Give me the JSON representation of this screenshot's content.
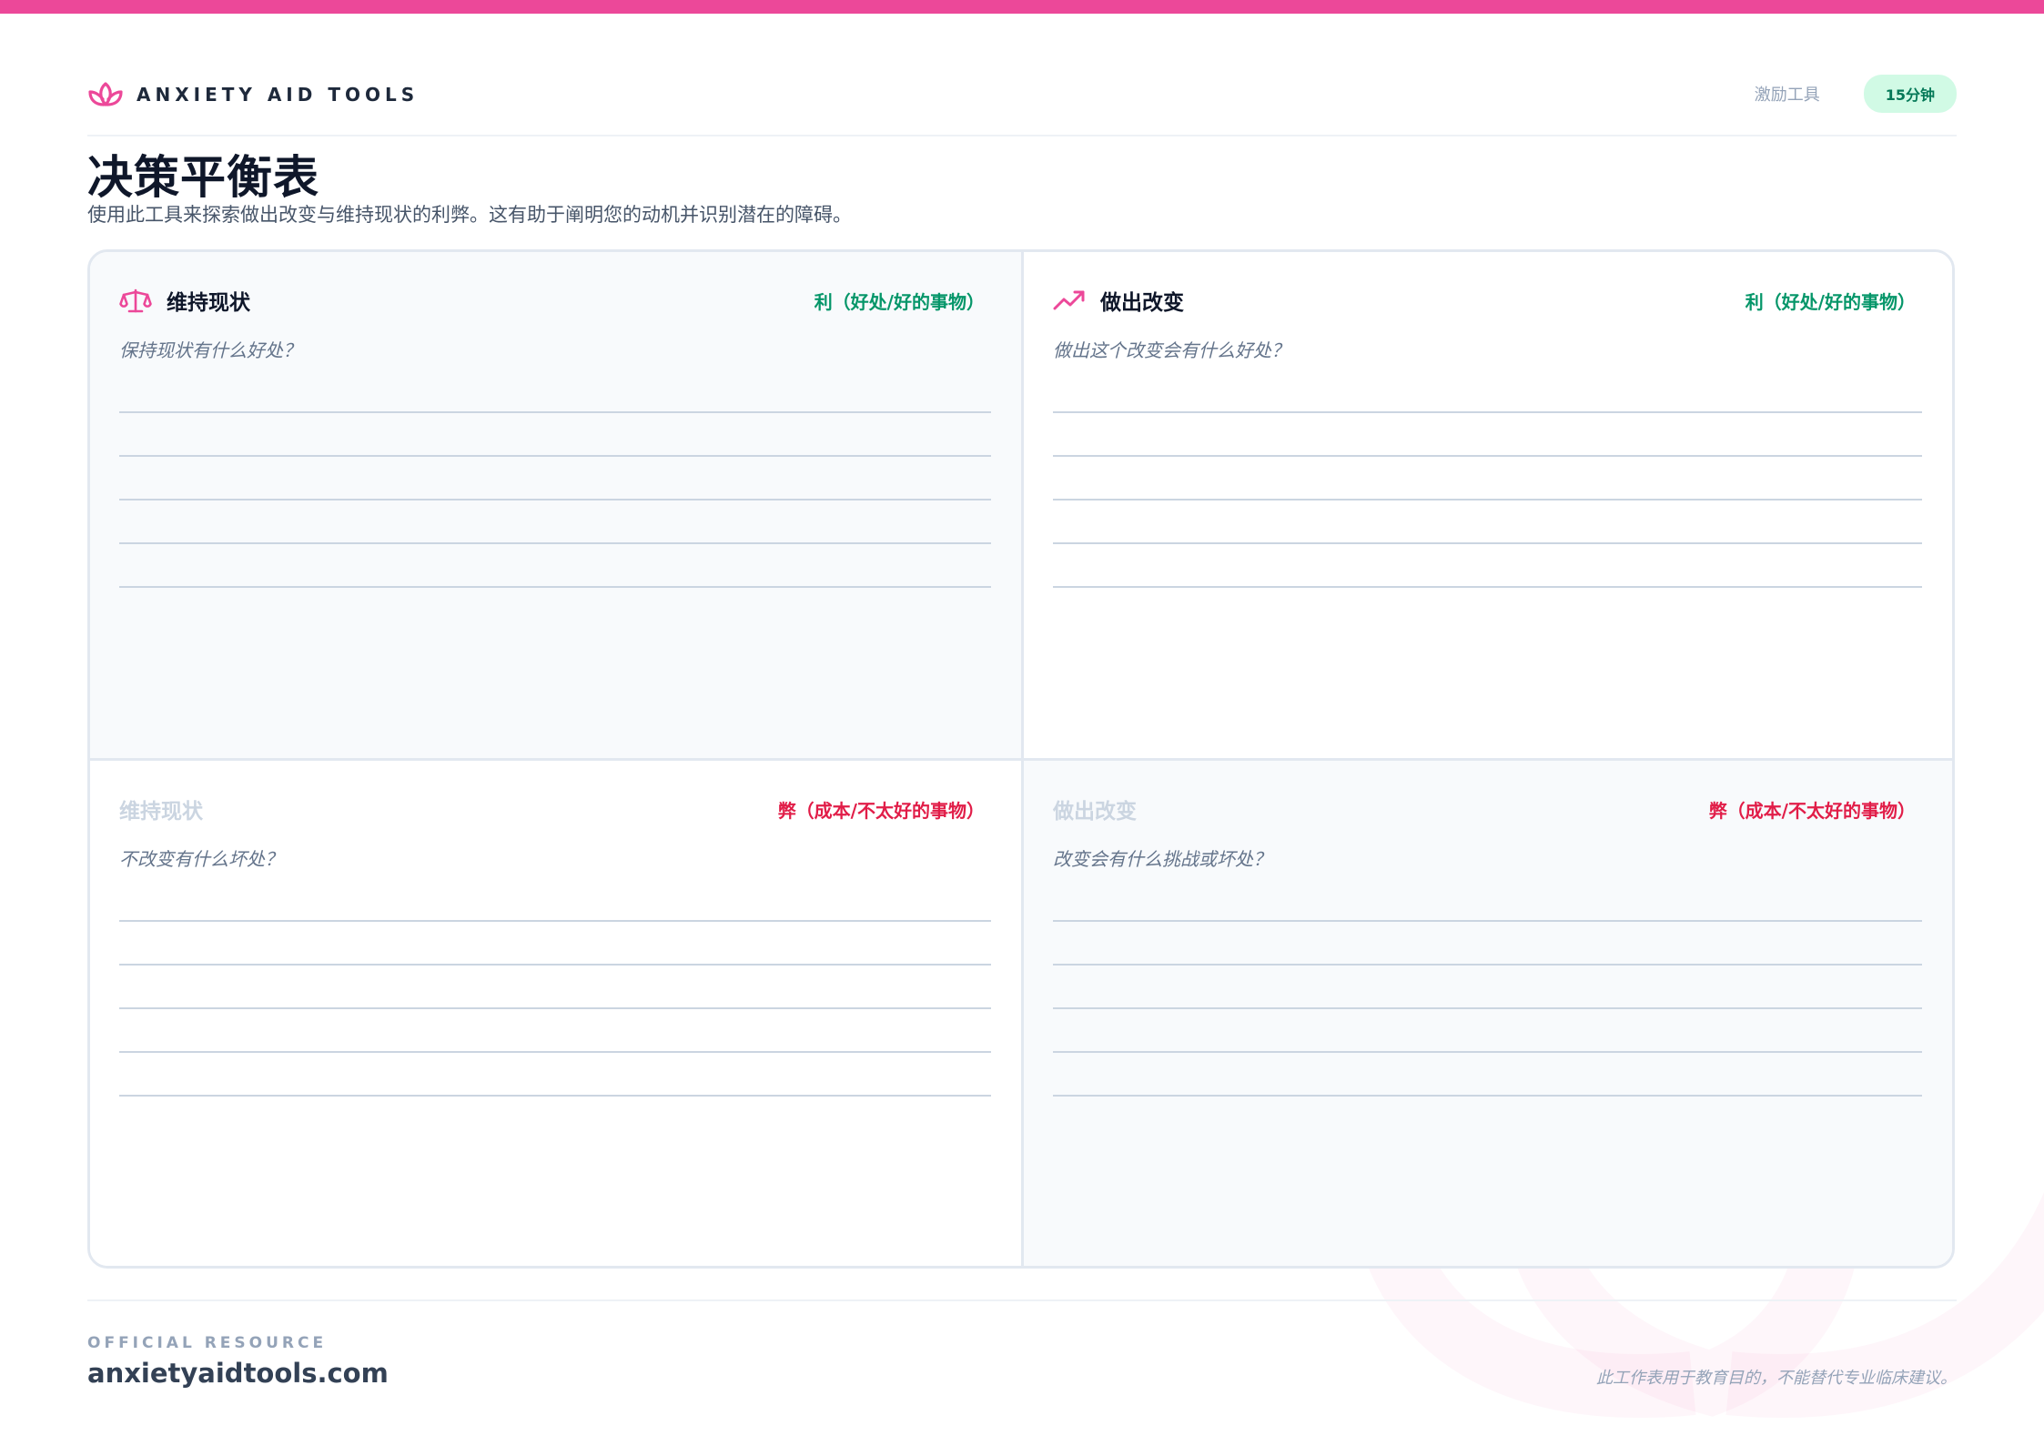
{
  "brand": {
    "name": "ANXIETY AID TOOLS",
    "icon": "lotus-icon",
    "accent": "#ec4899"
  },
  "header": {
    "category": "激励工具",
    "duration": "15分钟"
  },
  "page": {
    "title": "决策平衡表",
    "subtitle": "使用此工具来探索做出改变与维持现状的利弊。这有助于阐明您的动机并识别潜在的障碍。"
  },
  "quadrants": [
    {
      "title": "维持现状",
      "icon": "scale-icon",
      "tag": "利（好处/好的事物）",
      "prompt": "保持现状有什么好处？",
      "lines": 5
    },
    {
      "title": "做出改变",
      "icon": "trending-up-icon",
      "tag": "利（好处/好的事物）",
      "prompt": "做出这个改变会有什么好处？",
      "lines": 5
    },
    {
      "title": "维持现状",
      "tag": "弊（成本/不太好的事物）",
      "prompt": "不改变有什么坏处？",
      "lines": 5
    },
    {
      "title": "做出改变",
      "tag": "弊（成本/不太好的事物）",
      "prompt": "改变会有什么挑战或坏处？",
      "lines": 5
    }
  ],
  "colors": {
    "pro": "#059669",
    "con": "#e11d48",
    "pill_bg": "#d1fae5",
    "pill_text": "#047857"
  },
  "footer": {
    "label": "OFFICIAL RESOURCE",
    "url": "anxietyaidtools.com",
    "disclaimer": "此工作表用于教育目的，不能替代专业临床建议。"
  }
}
